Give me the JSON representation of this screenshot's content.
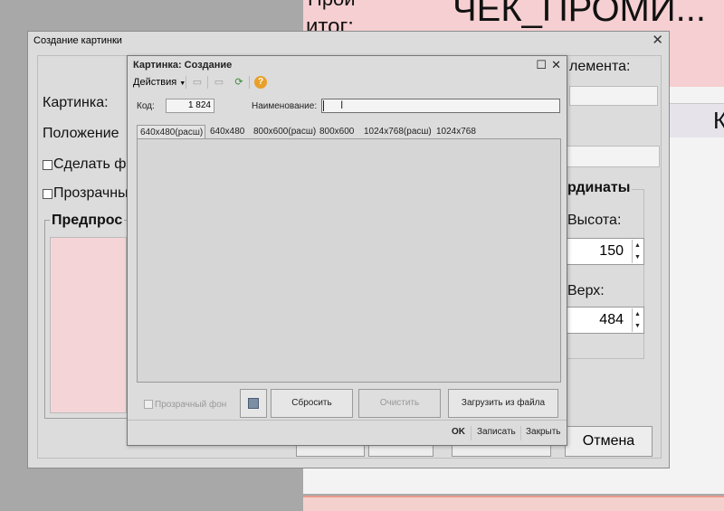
{
  "background": {
    "top_label_1": "Прой",
    "top_label_2": "итог:",
    "top_title": "ЧЕК_ПРОМИ...",
    "element_label": "лемента:",
    "right_label": "К"
  },
  "outer_dialog": {
    "title": "Создание картинки",
    "close": "✕",
    "label_picture": "Картинка:",
    "label_position": "Положение",
    "checkbox_make": "Сделать ф",
    "checkbox_transparent": "Прозрачны",
    "group_preview": "Предпрос",
    "group_coords": "рдинаты",
    "label_height": "Высота:",
    "height_value": "150",
    "label_top": "Верх:",
    "top_value": "484",
    "cancel_button": "Отмена"
  },
  "inner_dialog": {
    "title": "Картинка: Создание",
    "maximize": "☐",
    "close": "✕",
    "actions_menu": "Действия",
    "code_label": "Код:",
    "code_value": "1 824",
    "name_label": "Наименование:",
    "name_value": "",
    "tabs": [
      {
        "label": "640x480(расш)",
        "active": true
      },
      {
        "label": "640x480",
        "active": false
      },
      {
        "label": "800x600(расш)",
        "active": false
      },
      {
        "label": "800x600",
        "active": false
      },
      {
        "label": "1024x768(расш)",
        "active": false
      },
      {
        "label": "1024x768",
        "active": false
      }
    ],
    "transparent_bg": "Прозрачный фон",
    "reset_button": "Сбросить",
    "clear_button": "Очистить",
    "load_button": "Загрузить из файла",
    "ok_button": "OK",
    "save_button": "Записать",
    "close_button": "Закрыть"
  }
}
